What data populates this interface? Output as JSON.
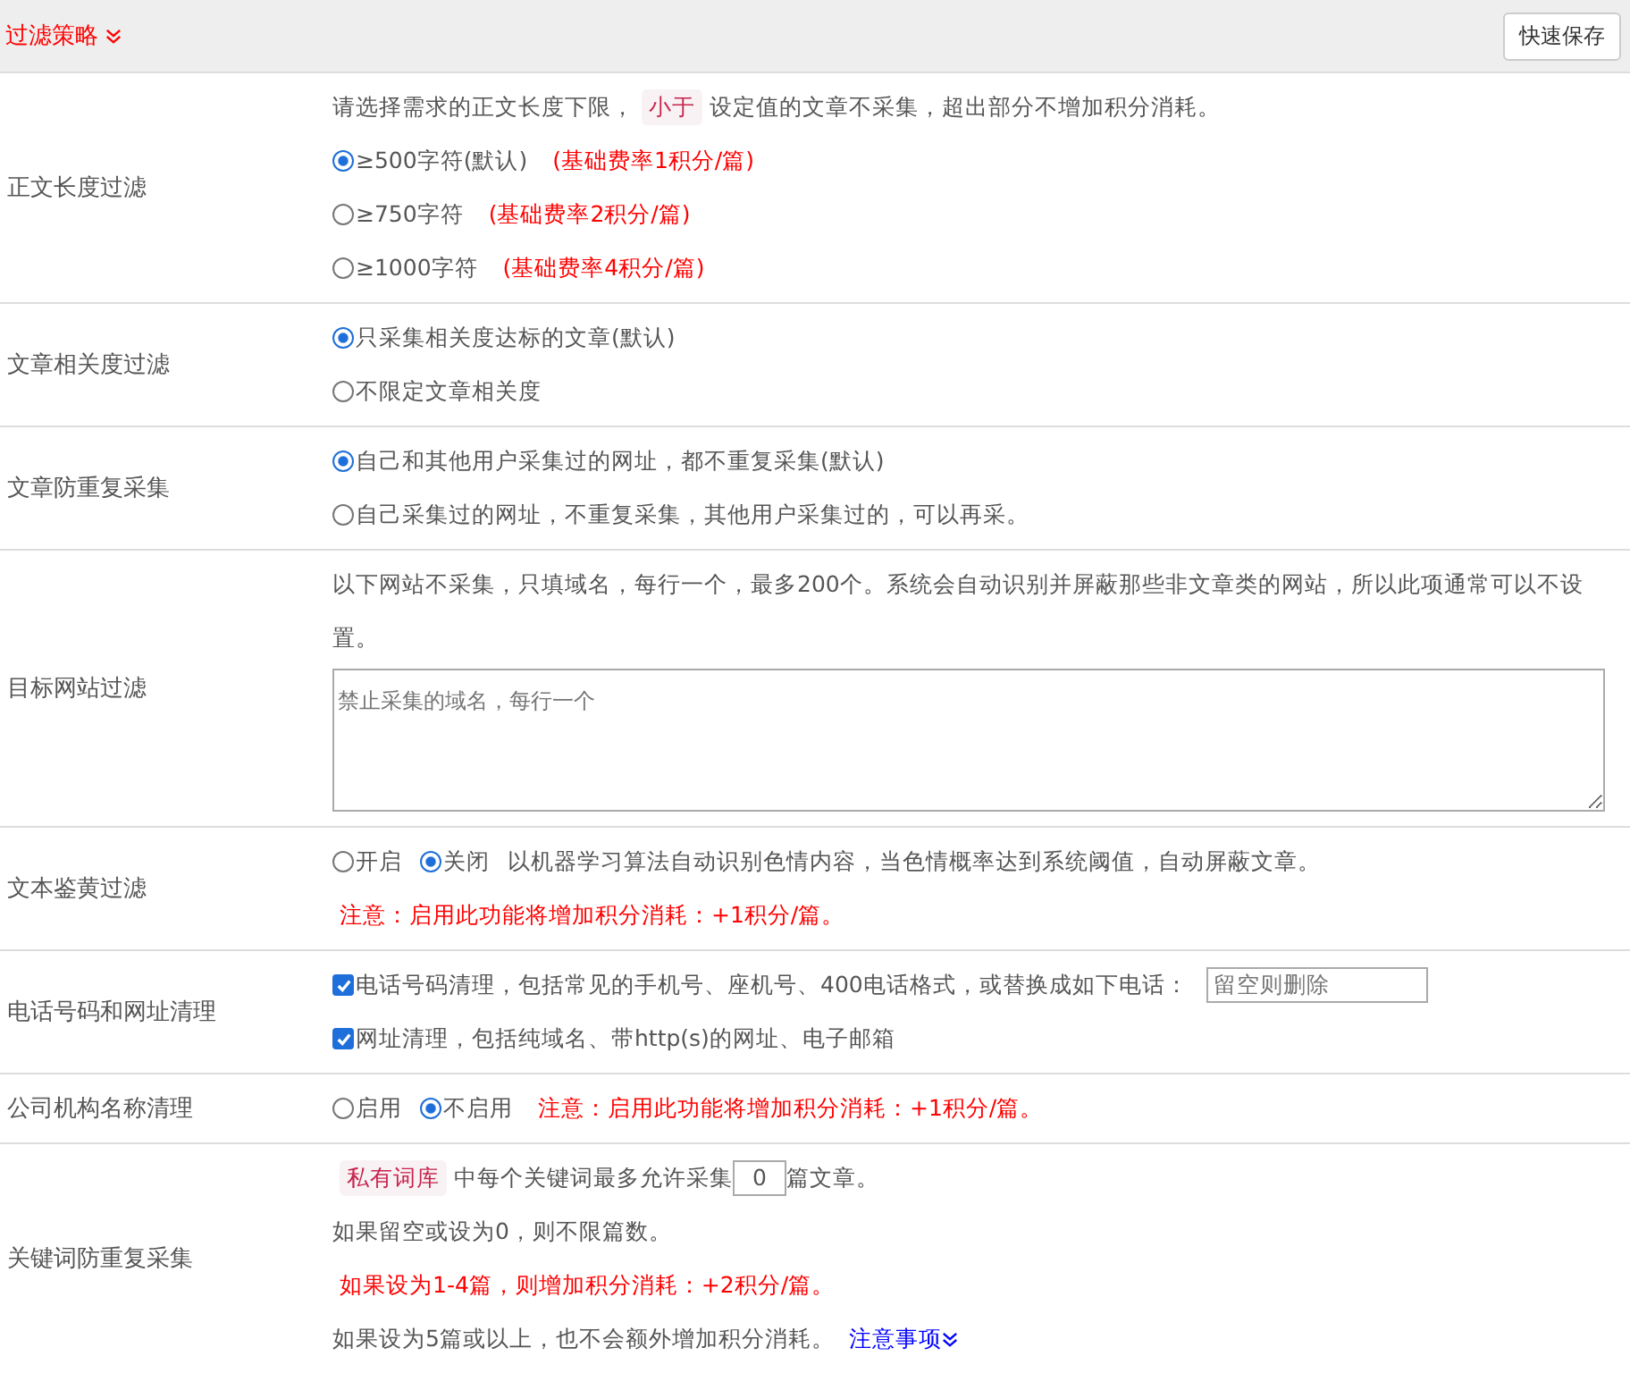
{
  "header": {
    "title": "过滤策略",
    "save_button": "快速保存"
  },
  "rows": [
    {
      "label": "正文长度过滤",
      "lines": [
        [
          {
            "kind": "text",
            "text": "请选择需求的正文长度下限，"
          },
          {
            "kind": "tag",
            "text": "小于"
          },
          {
            "kind": "text",
            "text": "设定值的文章不采集，超出部分不增加积分消耗。"
          }
        ],
        [
          {
            "kind": "radio",
            "label": "≥500字符(默认)",
            "selected": true
          },
          {
            "kind": "note",
            "text": "(基础费率1积分/篇)"
          }
        ],
        [
          {
            "kind": "radio",
            "label": "≥750字符",
            "selected": false
          },
          {
            "kind": "note",
            "text": "(基础费率2积分/篇)"
          }
        ],
        [
          {
            "kind": "radio",
            "label": "≥1000字符",
            "selected": false
          },
          {
            "kind": "note",
            "text": "(基础费率4积分/篇)"
          }
        ]
      ]
    },
    {
      "label": "文章相关度过滤",
      "lines": [
        [
          {
            "kind": "radio",
            "label": "只采集相关度达标的文章(默认)",
            "selected": true
          }
        ],
        [
          {
            "kind": "radio",
            "label": "不限定文章相关度",
            "selected": false
          }
        ]
      ]
    },
    {
      "label": "文章防重复采集",
      "lines": [
        [
          {
            "kind": "radio",
            "label": "自己和其他用户采集过的网址，都不重复采集(默认)",
            "selected": true
          }
        ],
        [
          {
            "kind": "radio",
            "label": "自己采集过的网址，不重复采集，其他用户采集过的，可以再采。",
            "selected": false
          }
        ]
      ]
    },
    {
      "label": "目标网站过滤",
      "lines": [
        [
          {
            "kind": "text",
            "text": "以下网站不采集，只填域名，每行一个，最多200个。系统会自动识别并屏蔽那些非文章类的网站，所以此项通常可以不设置。"
          }
        ],
        [
          {
            "kind": "textarea",
            "placeholder": "禁止采集的域名，每行一个"
          }
        ]
      ]
    },
    {
      "label": "文本鉴黄过滤",
      "lines": [
        [
          {
            "kind": "radio",
            "label": "开启",
            "selected": false
          },
          {
            "kind": "radio",
            "label": "关闭",
            "selected": true
          },
          {
            "kind": "text",
            "text": "以机器学习算法自动识别色情内容，当色情概率达到系统阈值，自动屏蔽文章。"
          }
        ],
        [
          {
            "kind": "note",
            "text": "注意：启用此功能将增加积分消耗：+1积分/篇。"
          }
        ]
      ]
    },
    {
      "label": "电话号码和网址清理",
      "lines": [
        [
          {
            "kind": "checkbox",
            "label": "电话号码清理，包括常见的手机号、座机号、400电话格式，或替换成如下电话：",
            "checked": true
          },
          {
            "kind": "input",
            "placeholder": "留空则删除"
          }
        ],
        [
          {
            "kind": "checkbox",
            "label": "网址清理，包括纯域名、带http(s)的网址、电子邮箱",
            "checked": true
          }
        ]
      ]
    },
    {
      "label": "公司机构名称清理",
      "lines": [
        [
          {
            "kind": "radio",
            "label": "启用",
            "selected": false
          },
          {
            "kind": "radio",
            "label": "不启用",
            "selected": true
          },
          {
            "kind": "note",
            "text": "注意：启用此功能将增加积分消耗：+1积分/篇。"
          }
        ]
      ]
    },
    {
      "label": "关键词防重复采集",
      "lines": [
        [
          {
            "kind": "tag",
            "text": "私有词库"
          },
          {
            "kind": "text",
            "text": "中每个关键词最多允许采集"
          },
          {
            "kind": "input",
            "value": "0"
          },
          {
            "kind": "text",
            "text": "篇文章。"
          }
        ],
        [
          {
            "kind": "text",
            "text": "如果留空或设为0，则不限篇数。"
          }
        ],
        [
          {
            "kind": "note",
            "text": "如果设为1-4篇，则增加积分消耗：+2积分/篇。"
          }
        ],
        [
          {
            "kind": "text",
            "text": "如果设为5篇或以上，也不会额外增加积分消耗。"
          },
          {
            "kind": "link",
            "text": "注意事项"
          }
        ]
      ]
    }
  ]
}
